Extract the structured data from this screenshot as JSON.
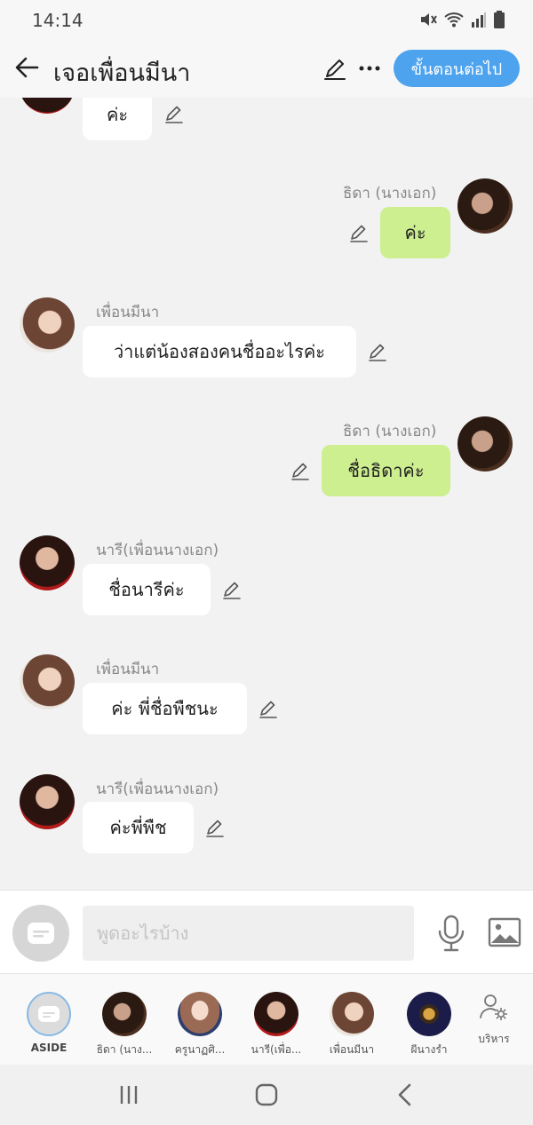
{
  "status_bar": {
    "time": "14:14"
  },
  "header": {
    "title": "เจอเพื่อนมีนา",
    "next_button": "ขั้นตอนต่อไป"
  },
  "messages": [
    {
      "side": "left",
      "sender": "",
      "text": "ค่ะ"
    },
    {
      "side": "right",
      "sender": "ธิดา (นางเอก)",
      "text": "ค่ะ"
    },
    {
      "side": "left",
      "sender": "เพื่อนมีนา",
      "text": "ว่าแต่น้องสองคนชื่ออะไรค่ะ"
    },
    {
      "side": "right",
      "sender": "ธิดา (นางเอก)",
      "text": "ชื่อธิดาค่ะ"
    },
    {
      "side": "left",
      "sender": "นารี(เพื่อนนางเอก)",
      "text": "ชื่อนารีค่ะ"
    },
    {
      "side": "left",
      "sender": "เพื่อนมีนา",
      "text": "ค่ะ พี่ชื่อพืชนะ"
    },
    {
      "side": "left",
      "sender": "นารี(เพื่อนนางเอก)",
      "text": "ค่ะพี่พืช"
    }
  ],
  "input": {
    "placeholder": "พูดอะไรบ้าง"
  },
  "characters": [
    {
      "label": "ASIDE"
    },
    {
      "label": "ธิดา (นาง..."
    },
    {
      "label": "ครูนาฏศิ..."
    },
    {
      "label": "นารี(เพื่อ..."
    },
    {
      "label": "เพื่อนมีนา"
    },
    {
      "label": "ผีนางรำ"
    },
    {
      "label": "บริหาร"
    }
  ],
  "colors": {
    "accent": "#4da3ee",
    "my_bubble": "#cdef8f",
    "other_bubble": "#ffffff",
    "chat_background": "#f2f2f2"
  },
  "icons": [
    "back-arrow-icon",
    "pencil-icon",
    "more-icon",
    "aside-chat-icon",
    "microphone-icon",
    "image-icon",
    "manage-user-icon",
    "recents-icon",
    "home-icon",
    "back-nav-icon"
  ]
}
